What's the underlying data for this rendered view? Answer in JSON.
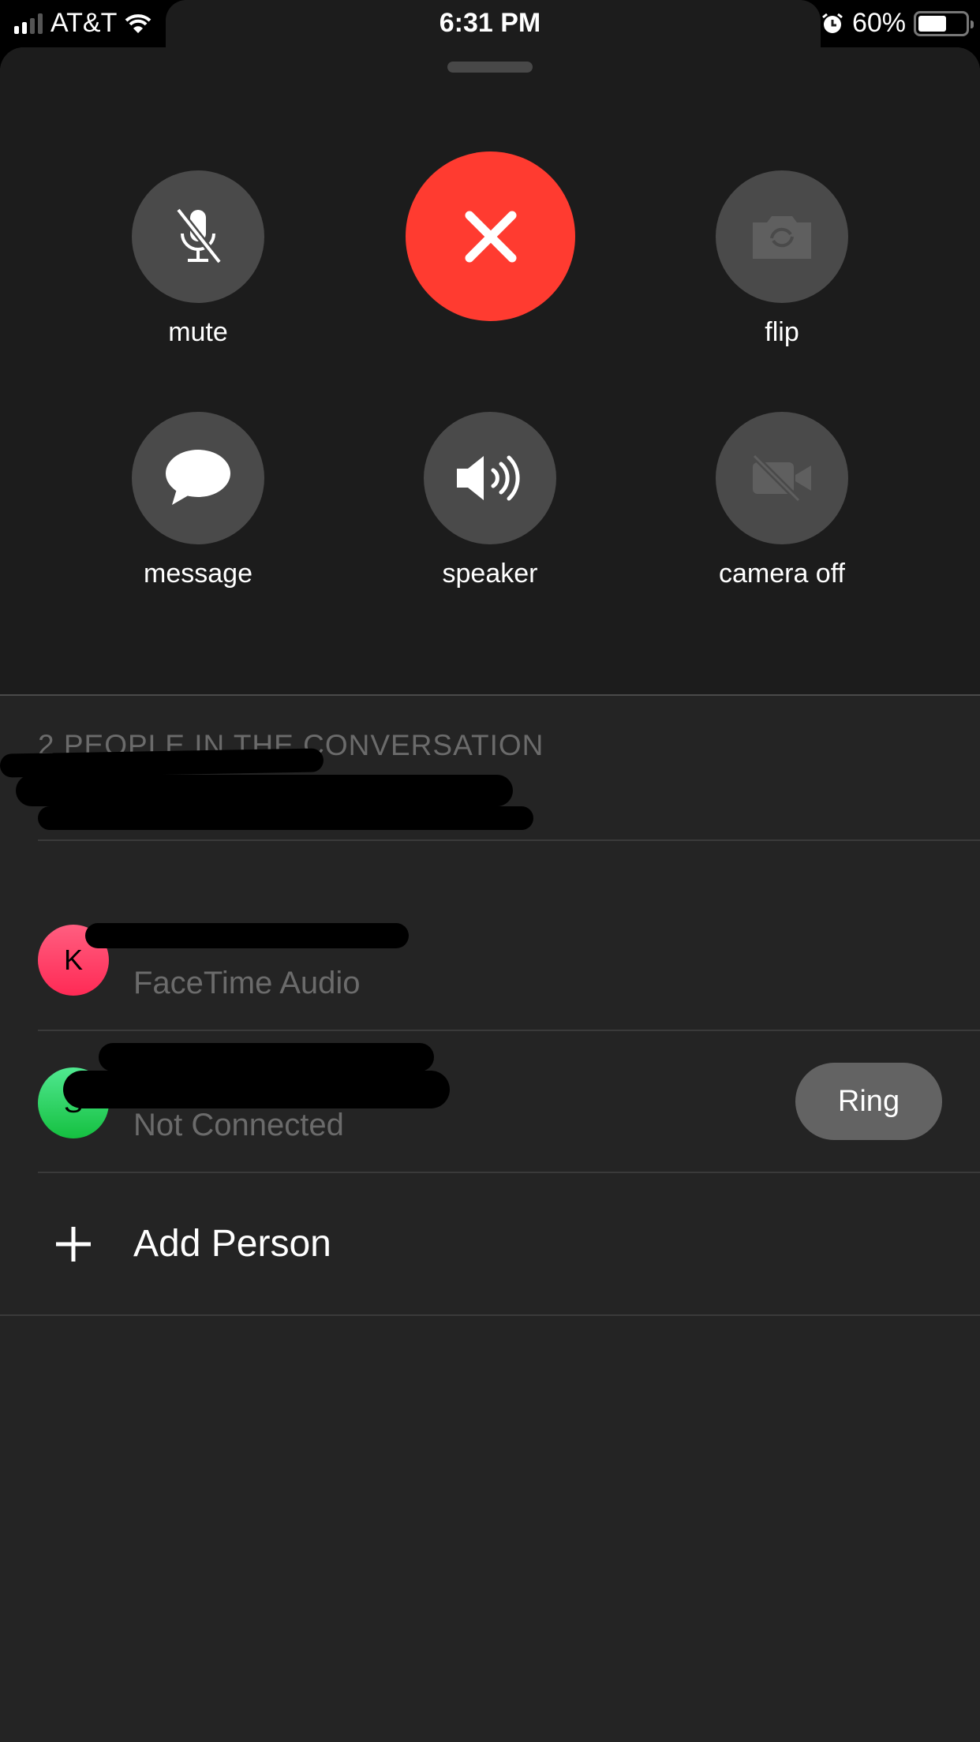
{
  "status_bar": {
    "carrier": "AT&T",
    "time": "6:31 PM",
    "battery": "60%",
    "battery_level": 0.6,
    "icons": [
      "signal-icon",
      "wifi-icon",
      "alarm-icon",
      "battery-icon"
    ]
  },
  "controls": [
    {
      "label": "mute",
      "icon": "mic-slash-icon"
    },
    {
      "label": "",
      "icon": "close-icon",
      "color": "#ff3b30"
    },
    {
      "label": "flip",
      "icon": "camera-flip-icon"
    },
    {
      "label": "message",
      "icon": "message-bubble-icon"
    },
    {
      "label": "speaker",
      "icon": "speaker-icon"
    },
    {
      "label": "camera off",
      "icon": "video-slash-icon"
    }
  ],
  "conversation": {
    "header": "2 PEOPLE IN THE CONVERSATION",
    "participants": [
      {
        "initial": "K",
        "status": "FaceTime Audio",
        "avatar_color": "#ff2d55"
      },
      {
        "initial": "S",
        "status": "Not Connected",
        "avatar_color": "#34c759",
        "action": "Ring"
      }
    ],
    "add_person": "Add Person"
  }
}
